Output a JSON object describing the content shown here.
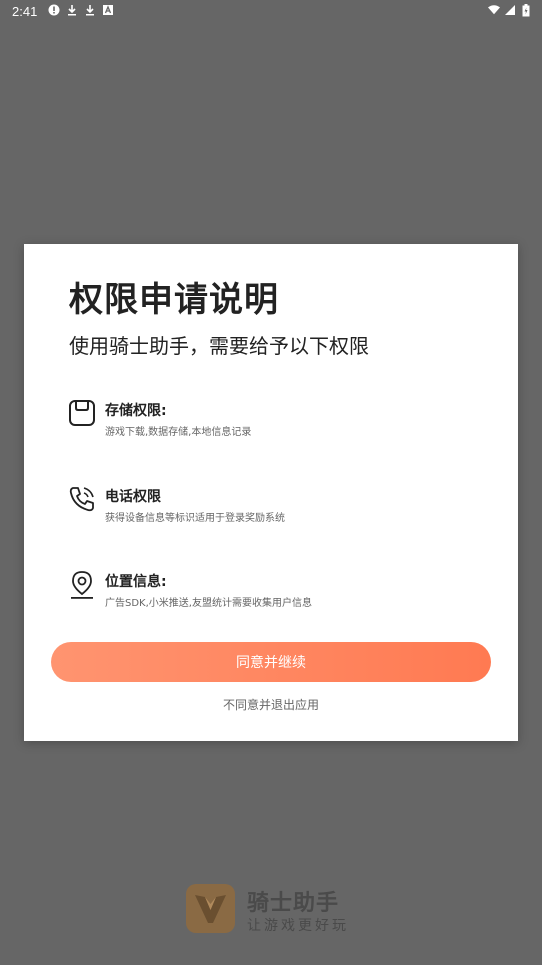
{
  "status_bar": {
    "time": "2:41",
    "left_icons": [
      "alert-icon",
      "download-icon",
      "download-icon",
      "a-icon"
    ],
    "right_icons": [
      "wifi-icon",
      "signal-icon",
      "battery-icon"
    ]
  },
  "dialog": {
    "title": "权限申请说明",
    "subtitle": "使用骑士助手，需要给予以下权限",
    "permissions": [
      {
        "icon": "storage-icon",
        "name": "存储权限:",
        "desc": "游戏下载,数据存储,本地信息记录"
      },
      {
        "icon": "phone-icon",
        "name": "电话权限",
        "desc": "获得设备信息等标识适用于登录奖励系统"
      },
      {
        "icon": "location-pin-icon",
        "name": "位置信息:",
        "desc": "广告SDK,小米推送,友盟统计需要收集用户信息"
      }
    ],
    "agree_label": "同意并继续",
    "decline_label": "不同意并退出应用"
  },
  "brand": {
    "name": "骑士助手",
    "slogan": "让游戏更好玩"
  },
  "colors": {
    "overlay": "#666666",
    "accent": "#ff8060",
    "logo": "#8a6a44"
  }
}
